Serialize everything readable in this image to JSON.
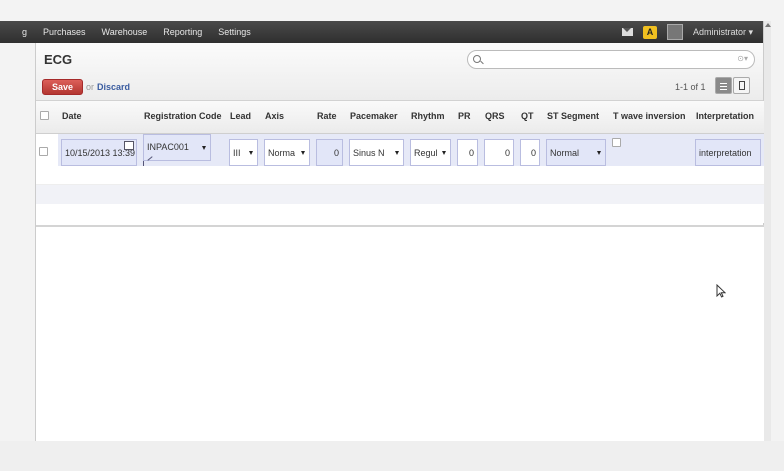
{
  "topbar": {
    "cut_left": "g",
    "menu": [
      "Purchases",
      "Warehouse",
      "Reporting",
      "Settings"
    ],
    "user": "Administrator ▾",
    "alert_glyph": "A"
  },
  "view": {
    "title": "ECG",
    "save_label": "Save",
    "or_label": "or",
    "discard_label": "Discard",
    "pager": "1-1 of 1",
    "search_opts": "⊙▾"
  },
  "table": {
    "headers": [
      "",
      "Date",
      "Registration Code",
      "Lead",
      "Axis",
      "Rate",
      "Pacemaker",
      "Rhythm",
      "PR",
      "QRS",
      "QT",
      "ST Segment",
      "T wave inversion",
      "Interpretation"
    ],
    "row": {
      "date": "10/15/2013 13:39",
      "registration_code": "INPAC001",
      "lead": "III",
      "axis": "Norma",
      "rate": "0",
      "pacemaker": "Sinus N",
      "rhythm": "Regul",
      "pr": "0",
      "qrs": "0",
      "qt": "0",
      "st_segment": "Normal",
      "interpretation": "interpretation"
    }
  },
  "colors": {
    "accent": "#b33630",
    "edit_row": "#e6e9f7",
    "topbar": "#3c3c3c"
  }
}
